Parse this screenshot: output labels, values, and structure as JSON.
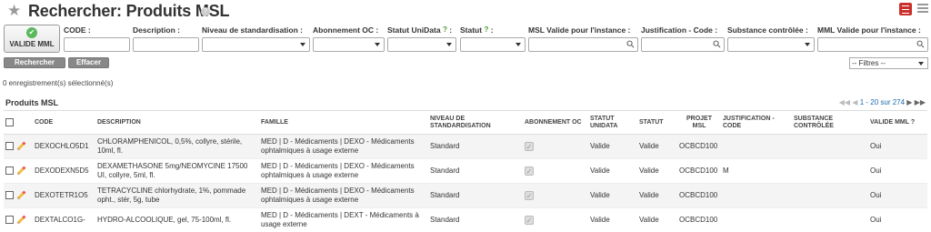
{
  "header": {
    "title": "Rechercher: Produits MSL",
    "help_icon": "question-icon",
    "star_icon": "star-icon"
  },
  "toolbar": {
    "valide_label": "VALIDE MML"
  },
  "filters": [
    {
      "label": "CODE :",
      "type": "text",
      "value": "",
      "help": ""
    },
    {
      "label": "Description :",
      "type": "text",
      "value": "",
      "help": ""
    },
    {
      "label": "Niveau de standardisation :",
      "type": "select",
      "value": "",
      "help": ""
    },
    {
      "label": "Abonnement OC :",
      "type": "select",
      "value": "",
      "help": ""
    },
    {
      "label": "Statut UniData",
      "type": "select",
      "value": "",
      "help": "?"
    },
    {
      "label": "Statut",
      "type": "select",
      "value": "",
      "help": "?"
    },
    {
      "label": "MSL Valide pour l'instance :",
      "type": "search",
      "value": "",
      "help": ""
    },
    {
      "label": "Justification - Code :",
      "type": "search",
      "value": "",
      "help": ""
    },
    {
      "label": "Substance contrôlée :",
      "type": "select",
      "value": "",
      "help": ""
    },
    {
      "label": "MML Valide pour l'instance :",
      "type": "search",
      "value": "",
      "help": ""
    }
  ],
  "actions": {
    "search_label": "Rechercher",
    "clear_label": "Effacer",
    "filters_select": "-- Filtres --"
  },
  "selection_info": "0 enregistrement(s) sélectionné(s)",
  "list": {
    "title": "Produits MSL",
    "pager_text": "1 - 20 sur 274",
    "columns": [
      "CODE",
      "DESCRIPTION",
      "FAMILLE",
      "NIVEAU DE STANDARDISATION",
      "ABONNEMENT OC",
      "STATUT UNIDATA",
      "STATUT",
      "PROJET MSL",
      "JUSTIFICATION - CODE",
      "SUBSTANCE CONTRÔLÉE",
      "VALIDE MML ?"
    ],
    "rows": [
      {
        "code": "DEXOCHLO5D1",
        "description": "CHLORAMPHENICOL, 0,5%, collyre, stérile, 10ml, fl.",
        "famille": "MED | D - Médicaments | DEXO - Médicaments ophtalmiques à usage externe",
        "niveau": "Standard",
        "statut_unidata": "Valide",
        "statut": "Valide",
        "projet": "OCBCD100",
        "justification": "",
        "substance": "",
        "valide": "Oui"
      },
      {
        "code": "DEXODEXN5D5",
        "description": "DEXAMETHASONE 5mg/NEOMYCINE 17500 UI, collyre, 5ml, fl.",
        "famille": "MED | D - Médicaments | DEXO - Médicaments ophtalmiques à usage externe",
        "niveau": "Standard",
        "statut_unidata": "Valide",
        "statut": "Valide",
        "projet": "OCBCD100",
        "justification": "M",
        "substance": "",
        "valide": "Oui"
      },
      {
        "code": "DEXOTETR1O5",
        "description": "TETRACYCLINE chlorhydrate, 1%, pommade opht., stér, 5g, tube",
        "famille": "MED | D - Médicaments | DEXO - Médicaments ophtalmiques à usage externe",
        "niveau": "Standard",
        "statut_unidata": "Valide",
        "statut": "Valide",
        "projet": "OCBCD100",
        "justification": "",
        "substance": "",
        "valide": "Oui"
      },
      {
        "code": "DEXTALCO1G-",
        "description": "HYDRO-ALCOOLIQUE, gel, 75-100ml, fl.",
        "famille": "MED | D - Médicaments | DEXT - Médicaments à usage externe",
        "niveau": "Standard",
        "statut_unidata": "Valide",
        "statut": "Valide",
        "projet": "OCBCD100",
        "justification": "",
        "substance": "",
        "valide": "Oui"
      }
    ]
  },
  "colors": {
    "accent_red": "#c9302c",
    "valide_green": "#5cb85c",
    "link_blue": "#1a6ab0"
  }
}
